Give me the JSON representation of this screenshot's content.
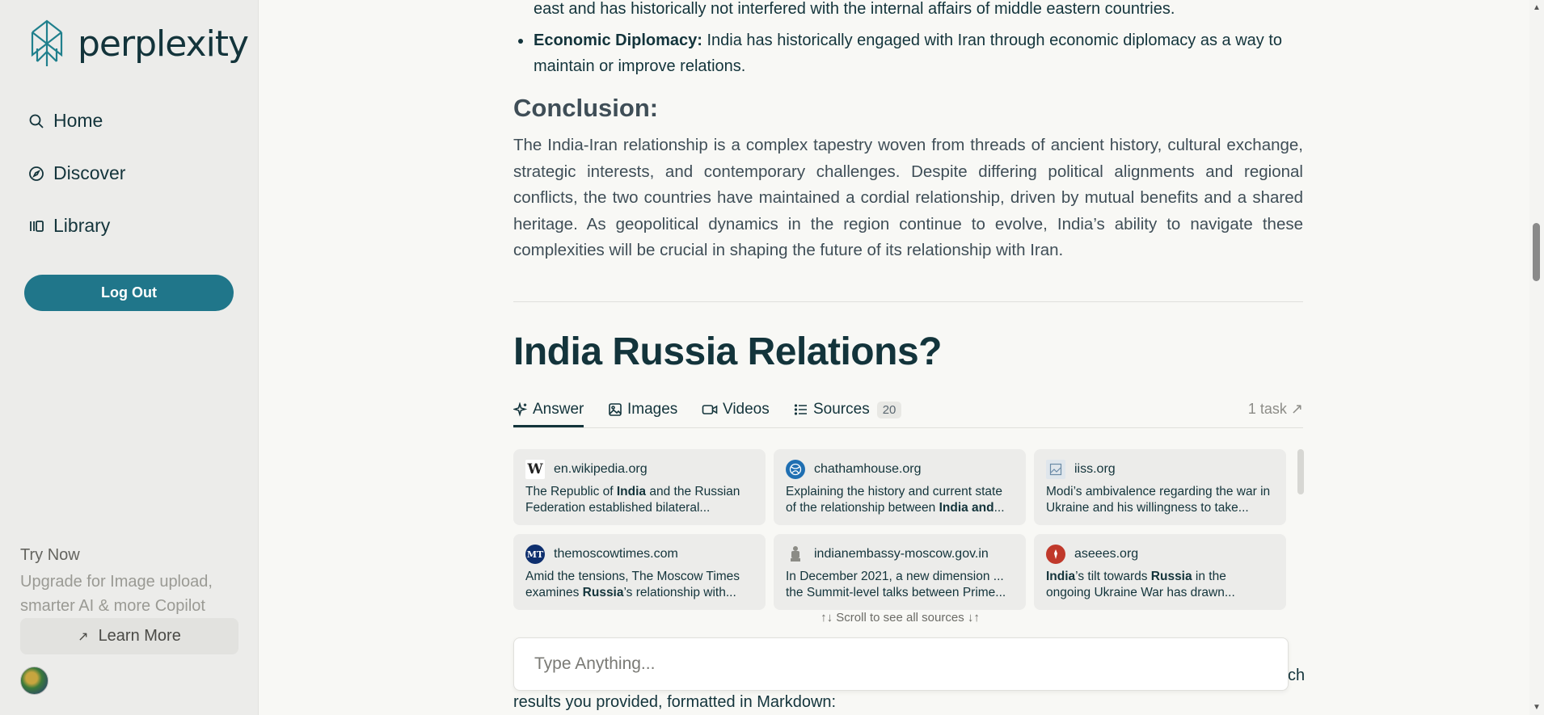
{
  "sidebar": {
    "logo_text": "perplexity",
    "nav": [
      {
        "label": "Home",
        "icon": "search-icon"
      },
      {
        "label": "Discover",
        "icon": "compass-icon"
      },
      {
        "label": "Library",
        "icon": "library-icon"
      }
    ],
    "logout_label": "Log Out",
    "try_now": "Try Now",
    "upgrade_text": "Upgrade for Image upload, smarter AI & more Copilot",
    "learn_more": "Learn More"
  },
  "content": {
    "bullet1_tail": "east and has historically not interfered with the internal affairs of middle eastern countries.",
    "bullet2_title": "Economic Diplomacy:",
    "bullet2_text": " India has historically engaged with Iran through economic diplomacy as a way to maintain or improve relations.",
    "conclusion_heading": "Conclusion:",
    "conclusion_text": "The India-Iran relationship is a complex tapestry woven from threads of ancient history, cultural exchange, strategic interests, and contemporary challenges. Despite differing political alignments and regional conflicts, the two countries have maintained a cordial relationship, driven by mutual benefits and a shared heritage. As geopolitical dynamics in the region continue to evolve, India’s ability to navigate these complexities will be crucial in shaping the future of its relationship with Iran.",
    "question": "India Russia Relations?"
  },
  "tabs": {
    "answer": "Answer",
    "images": "Images",
    "videos": "Videos",
    "sources": "Sources",
    "sources_count": "20",
    "task": "1 task ↗"
  },
  "sources": [
    {
      "domain": "en.wikipedia.org",
      "snippet_html": "The Republic of <b>India</b> and the Russian Federation established bilateral...",
      "fav_text": "W",
      "fav_color": "#ffffff"
    },
    {
      "domain": "chathamhouse.org",
      "snippet_html": "Explaining the history and current state of the relationship between <b>India and</b>...",
      "fav_text": "",
      "fav_color": "#1f6fb2"
    },
    {
      "domain": "iiss.org",
      "snippet_html": "Modi’s ambivalence regarding the war in Ukraine and his willingness to take...",
      "fav_text": "",
      "fav_color": "#dfe6ec"
    },
    {
      "domain": "themoscowtimes.com",
      "snippet_html": "Amid the tensions, The Moscow Times examines <b>Russia</b>’s relationship with...",
      "fav_text": "MT",
      "fav_color": "#0e2f6e"
    },
    {
      "domain": "indianembassy-moscow.gov.in",
      "snippet_html": "In December 2021, a new dimension ... the Summit-level talks between Prime...",
      "fav_text": "",
      "fav_color": "#8c8c86"
    },
    {
      "domain": "aseees.org",
      "snippet_html": "<b>India</b>’s tilt towards <b>Russia</b> in the ongoing Ukraine War has drawn...",
      "fav_text": "",
      "fav_color": "#c0392b"
    }
  ],
  "scroll_hint": "↑↓ Scroll to see all sources ↓↑",
  "input": {
    "placeholder": "Type Anything..."
  },
  "under_text": "results you provided, formatted in Markdown:",
  "under_ch": "ch",
  "colors": {
    "accent": "#20768a",
    "text": "#13343b",
    "bg": "#f8f8f5",
    "sidebar_bg": "#ececea"
  }
}
